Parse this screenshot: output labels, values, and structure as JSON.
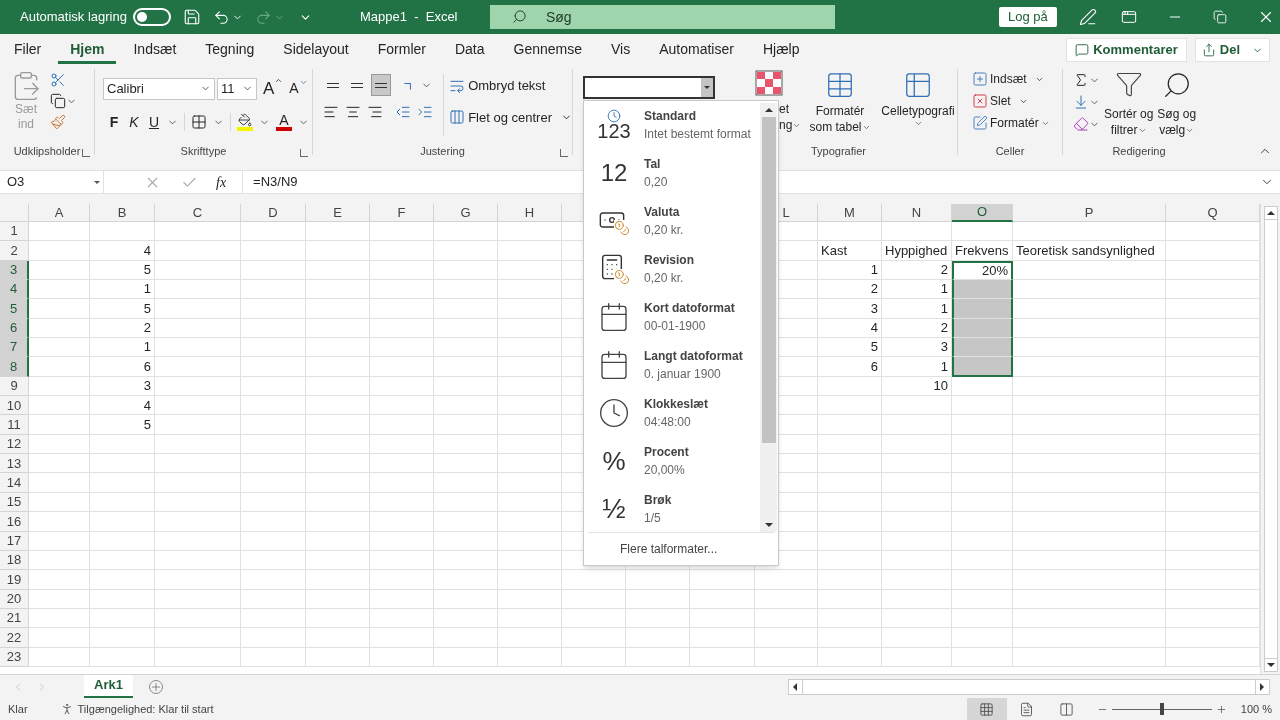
{
  "autosave": {
    "label": "Automatisk lagring",
    "on": false
  },
  "title": "Mappe1  -  Excel",
  "search": {
    "placeholder": "Søg"
  },
  "sign_in": "Log på",
  "tabs": [
    {
      "label": "Filer",
      "selected": false
    },
    {
      "label": "Hjem",
      "selected": true
    },
    {
      "label": "Indsæt",
      "selected": false
    },
    {
      "label": "Tegning",
      "selected": false
    },
    {
      "label": "Sidelayout",
      "selected": false
    },
    {
      "label": "Formler",
      "selected": false
    },
    {
      "label": "Data",
      "selected": false
    },
    {
      "label": "Gennemse",
      "selected": false
    },
    {
      "label": "Vis",
      "selected": false
    },
    {
      "label": "Automatiser",
      "selected": false
    },
    {
      "label": "Hjælp",
      "selected": false
    }
  ],
  "comments": "Kommentarer",
  "share": "Del",
  "ribbon": {
    "clipboard": {
      "paste_lines": [
        "Sæt",
        "ind"
      ],
      "label": "Udklipsholder"
    },
    "font": {
      "name": "Calibri",
      "size": "11",
      "grow": "A",
      "shrink": "A",
      "bold": "F",
      "italic": "K",
      "underline": "U",
      "color_letter": "A",
      "label": "Skrifttype"
    },
    "alignment": {
      "vertical": [
        {
          "selected": false
        },
        {
          "selected": false
        },
        {
          "selected": true
        }
      ],
      "wrap": "Ombryd tekst",
      "merge": "Flet og centrer",
      "label": "Justering"
    },
    "styles": {
      "conditional_parts": [
        "et",
        "ng"
      ],
      "table_lines": [
        "Formatér",
        "som tabel"
      ],
      "cell_styles": "Celletypografi",
      "label": "Typografier"
    },
    "cells": {
      "insert": "Indsæt",
      "delete": "Slet",
      "format": "Formatér",
      "label": "Celler"
    },
    "editing": {
      "sort_lines": [
        "Sortér og",
        "filtrer"
      ],
      "find_lines": [
        "Søg og",
        "vælg"
      ],
      "label": "Redigering"
    }
  },
  "formula_bar": {
    "name_box": "O3",
    "fx": "fx",
    "formula": "=N3/N9"
  },
  "number_formats": [
    {
      "kind": "general",
      "glyph": "123",
      "title": "Standard",
      "example": "Intet bestemt format"
    },
    {
      "kind": "number",
      "glyph": "12",
      "title": "Tal",
      "example": "0,20"
    },
    {
      "kind": "currency",
      "title": "Valuta",
      "example": "0,20 kr."
    },
    {
      "kind": "accounting",
      "title": "Revision",
      "example": "0,20 kr."
    },
    {
      "kind": "date",
      "title": "Kort datoformat",
      "example": "00-01-1900"
    },
    {
      "kind": "date",
      "title": "Langt datoformat",
      "example": "0. januar 1900"
    },
    {
      "kind": "time",
      "title": "Klokkeslæt",
      "example": "04:48:00"
    },
    {
      "kind": "percent",
      "glyph": "%",
      "title": "Procent",
      "example": "20,00%"
    },
    {
      "kind": "fraction",
      "glyph": "½",
      "title": "Brøk",
      "example": "1/5"
    }
  ],
  "more_formats": "Flere talformater...",
  "sheet": {
    "columns_left": [
      {
        "label": "A",
        "selected": false
      },
      {
        "label": "B",
        "selected": false
      },
      {
        "label": "C",
        "selected": false
      },
      {
        "label": "D",
        "selected": false
      },
      {
        "label": "E",
        "selected": false
      },
      {
        "label": "F",
        "selected": false
      },
      {
        "label": "G",
        "selected": false
      },
      {
        "label": "H",
        "selected": false
      }
    ],
    "columns_right": [
      {
        "label": "L",
        "selected": false
      },
      {
        "label": "M",
        "selected": false
      },
      {
        "label": "N",
        "selected": false
      },
      {
        "label": "O",
        "selected": true
      },
      {
        "label": "P",
        "selected": false
      },
      {
        "label": "Q",
        "selected": false
      }
    ],
    "rows": [
      {
        "label": "1",
        "selected": false
      },
      {
        "label": "2",
        "selected": false,
        "cells": {
          "b": {
            "kind": "number",
            "value": "4"
          },
          "m": {
            "kind": "text",
            "value": "Kast"
          },
          "n": {
            "kind": "text",
            "value": "Hyppighed"
          },
          "o": {
            "kind": "text",
            "value": "Frekvens"
          },
          "p": {
            "kind": "text",
            "value": "Teoretisk sandsynlighed"
          }
        }
      },
      {
        "label": "3",
        "selected": true,
        "cells": {
          "b": {
            "kind": "number",
            "value": "5"
          },
          "m": {
            "kind": "number",
            "value": "1"
          },
          "n": {
            "kind": "number",
            "value": "2"
          },
          "o": {
            "kind": "number",
            "value": "20%",
            "active": true
          }
        }
      },
      {
        "label": "4",
        "selected": true,
        "cells": {
          "b": {
            "kind": "number",
            "value": "1"
          },
          "m": {
            "kind": "number",
            "value": "2"
          },
          "n": {
            "kind": "number",
            "value": "1"
          }
        }
      },
      {
        "label": "5",
        "selected": true,
        "cells": {
          "b": {
            "kind": "number",
            "value": "5"
          },
          "m": {
            "kind": "number",
            "value": "3"
          },
          "n": {
            "kind": "number",
            "value": "1"
          }
        }
      },
      {
        "label": "6",
        "selected": true,
        "cells": {
          "b": {
            "kind": "number",
            "value": "2"
          },
          "m": {
            "kind": "number",
            "value": "4"
          },
          "n": {
            "kind": "number",
            "value": "2"
          }
        }
      },
      {
        "label": "7",
        "selected": true,
        "cells": {
          "b": {
            "kind": "number",
            "value": "1"
          },
          "m": {
            "kind": "number",
            "value": "5"
          },
          "n": {
            "kind": "number",
            "value": "3"
          }
        }
      },
      {
        "label": "8",
        "selected": true,
        "cells": {
          "b": {
            "kind": "number",
            "value": "6"
          },
          "m": {
            "kind": "number",
            "value": "6"
          },
          "n": {
            "kind": "number",
            "value": "1"
          }
        }
      },
      {
        "label": "9",
        "selected": false,
        "cells": {
          "b": {
            "kind": "number",
            "value": "3"
          },
          "n": {
            "kind": "number",
            "value": "10"
          }
        }
      },
      {
        "label": "10",
        "selected": false,
        "cells": {
          "b": {
            "kind": "number",
            "value": "4"
          }
        }
      },
      {
        "label": "11",
        "selected": false,
        "cells": {
          "b": {
            "kind": "number",
            "value": "5"
          }
        }
      },
      {
        "label": "12",
        "selected": false
      },
      {
        "label": "13",
        "selected": false
      },
      {
        "label": "14",
        "selected": false
      },
      {
        "label": "15",
        "selected": false
      },
      {
        "label": "16",
        "selected": false
      },
      {
        "label": "17",
        "selected": false
      },
      {
        "label": "18",
        "selected": false
      },
      {
        "label": "19",
        "selected": false
      },
      {
        "label": "20",
        "selected": false
      },
      {
        "label": "21",
        "selected": false
      },
      {
        "label": "22",
        "selected": false
      },
      {
        "label": "23",
        "selected": false
      }
    ]
  },
  "sheet_tabs": [
    {
      "label": "Ark1",
      "selected": true
    }
  ],
  "status": {
    "ready": "Klar",
    "accessibility": "Tilgængelighed: Klar til start",
    "views": [
      {
        "kind": "normal",
        "selected": true
      },
      {
        "kind": "page_layout",
        "selected": false
      },
      {
        "kind": "page_break",
        "selected": false
      }
    ],
    "zoom": {
      "level": 0.5,
      "reading": "100 %"
    }
  }
}
